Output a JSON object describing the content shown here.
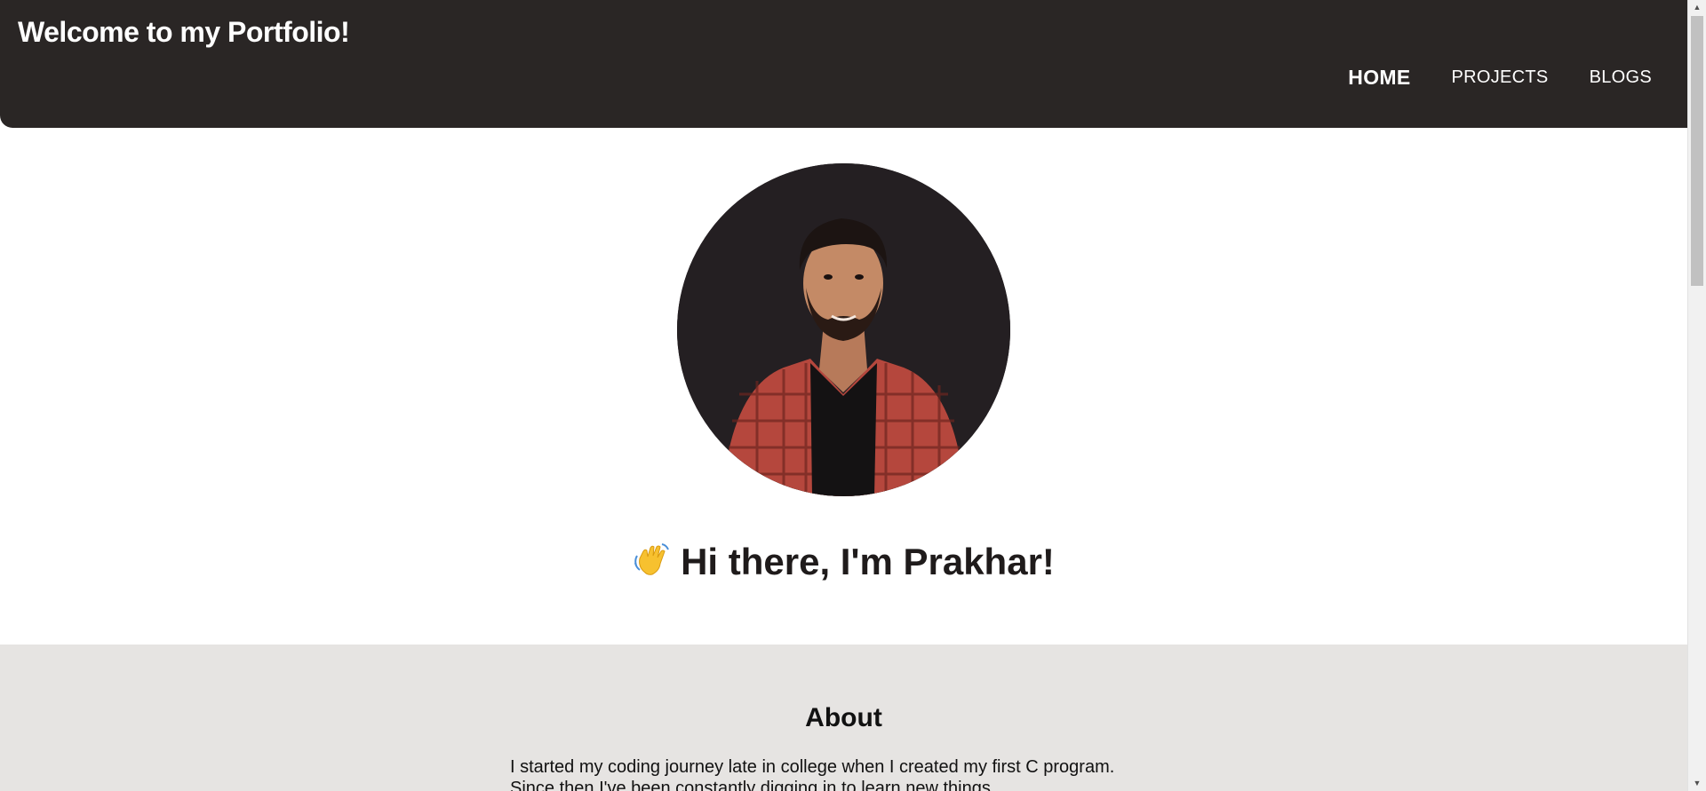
{
  "header": {
    "title": "Welcome to my Portfolio!",
    "nav": [
      {
        "label": "HOME",
        "active": true
      },
      {
        "label": "PROJECTS",
        "active": false
      },
      {
        "label": "BLOGS",
        "active": false
      }
    ]
  },
  "hero": {
    "avatar_icon": "person-portrait",
    "greeting_emoji": "waving-hand-icon",
    "greeting": "Hi there, I'm Prakhar!"
  },
  "about": {
    "title": "About",
    "text": "I started my coding journey late in college when I created my first C program. Since then I've been constantly digging in to learn new things"
  },
  "colors": {
    "header_bg": "#2a2625",
    "about_bg": "#e6e4e2",
    "avatar_bg": "#241f22",
    "shirt": "#b5473d"
  }
}
